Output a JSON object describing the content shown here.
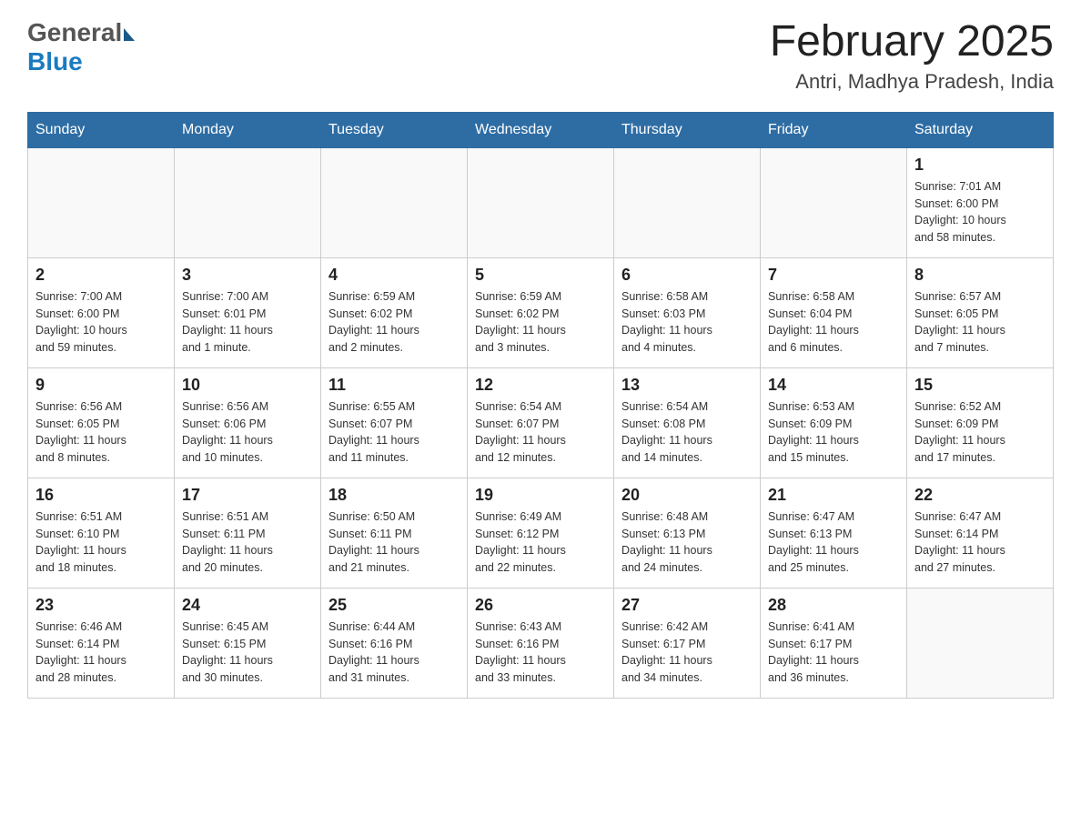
{
  "header": {
    "logo": {
      "general": "General",
      "blue": "Blue"
    },
    "title": "February 2025",
    "location": "Antri, Madhya Pradesh, India"
  },
  "days_of_week": [
    "Sunday",
    "Monday",
    "Tuesday",
    "Wednesday",
    "Thursday",
    "Friday",
    "Saturday"
  ],
  "weeks": [
    [
      {
        "day": "",
        "info": ""
      },
      {
        "day": "",
        "info": ""
      },
      {
        "day": "",
        "info": ""
      },
      {
        "day": "",
        "info": ""
      },
      {
        "day": "",
        "info": ""
      },
      {
        "day": "",
        "info": ""
      },
      {
        "day": "1",
        "info": "Sunrise: 7:01 AM\nSunset: 6:00 PM\nDaylight: 10 hours\nand 58 minutes."
      }
    ],
    [
      {
        "day": "2",
        "info": "Sunrise: 7:00 AM\nSunset: 6:00 PM\nDaylight: 10 hours\nand 59 minutes."
      },
      {
        "day": "3",
        "info": "Sunrise: 7:00 AM\nSunset: 6:01 PM\nDaylight: 11 hours\nand 1 minute."
      },
      {
        "day": "4",
        "info": "Sunrise: 6:59 AM\nSunset: 6:02 PM\nDaylight: 11 hours\nand 2 minutes."
      },
      {
        "day": "5",
        "info": "Sunrise: 6:59 AM\nSunset: 6:02 PM\nDaylight: 11 hours\nand 3 minutes."
      },
      {
        "day": "6",
        "info": "Sunrise: 6:58 AM\nSunset: 6:03 PM\nDaylight: 11 hours\nand 4 minutes."
      },
      {
        "day": "7",
        "info": "Sunrise: 6:58 AM\nSunset: 6:04 PM\nDaylight: 11 hours\nand 6 minutes."
      },
      {
        "day": "8",
        "info": "Sunrise: 6:57 AM\nSunset: 6:05 PM\nDaylight: 11 hours\nand 7 minutes."
      }
    ],
    [
      {
        "day": "9",
        "info": "Sunrise: 6:56 AM\nSunset: 6:05 PM\nDaylight: 11 hours\nand 8 minutes."
      },
      {
        "day": "10",
        "info": "Sunrise: 6:56 AM\nSunset: 6:06 PM\nDaylight: 11 hours\nand 10 minutes."
      },
      {
        "day": "11",
        "info": "Sunrise: 6:55 AM\nSunset: 6:07 PM\nDaylight: 11 hours\nand 11 minutes."
      },
      {
        "day": "12",
        "info": "Sunrise: 6:54 AM\nSunset: 6:07 PM\nDaylight: 11 hours\nand 12 minutes."
      },
      {
        "day": "13",
        "info": "Sunrise: 6:54 AM\nSunset: 6:08 PM\nDaylight: 11 hours\nand 14 minutes."
      },
      {
        "day": "14",
        "info": "Sunrise: 6:53 AM\nSunset: 6:09 PM\nDaylight: 11 hours\nand 15 minutes."
      },
      {
        "day": "15",
        "info": "Sunrise: 6:52 AM\nSunset: 6:09 PM\nDaylight: 11 hours\nand 17 minutes."
      }
    ],
    [
      {
        "day": "16",
        "info": "Sunrise: 6:51 AM\nSunset: 6:10 PM\nDaylight: 11 hours\nand 18 minutes."
      },
      {
        "day": "17",
        "info": "Sunrise: 6:51 AM\nSunset: 6:11 PM\nDaylight: 11 hours\nand 20 minutes."
      },
      {
        "day": "18",
        "info": "Sunrise: 6:50 AM\nSunset: 6:11 PM\nDaylight: 11 hours\nand 21 minutes."
      },
      {
        "day": "19",
        "info": "Sunrise: 6:49 AM\nSunset: 6:12 PM\nDaylight: 11 hours\nand 22 minutes."
      },
      {
        "day": "20",
        "info": "Sunrise: 6:48 AM\nSunset: 6:13 PM\nDaylight: 11 hours\nand 24 minutes."
      },
      {
        "day": "21",
        "info": "Sunrise: 6:47 AM\nSunset: 6:13 PM\nDaylight: 11 hours\nand 25 minutes."
      },
      {
        "day": "22",
        "info": "Sunrise: 6:47 AM\nSunset: 6:14 PM\nDaylight: 11 hours\nand 27 minutes."
      }
    ],
    [
      {
        "day": "23",
        "info": "Sunrise: 6:46 AM\nSunset: 6:14 PM\nDaylight: 11 hours\nand 28 minutes."
      },
      {
        "day": "24",
        "info": "Sunrise: 6:45 AM\nSunset: 6:15 PM\nDaylight: 11 hours\nand 30 minutes."
      },
      {
        "day": "25",
        "info": "Sunrise: 6:44 AM\nSunset: 6:16 PM\nDaylight: 11 hours\nand 31 minutes."
      },
      {
        "day": "26",
        "info": "Sunrise: 6:43 AM\nSunset: 6:16 PM\nDaylight: 11 hours\nand 33 minutes."
      },
      {
        "day": "27",
        "info": "Sunrise: 6:42 AM\nSunset: 6:17 PM\nDaylight: 11 hours\nand 34 minutes."
      },
      {
        "day": "28",
        "info": "Sunrise: 6:41 AM\nSunset: 6:17 PM\nDaylight: 11 hours\nand 36 minutes."
      },
      {
        "day": "",
        "info": ""
      }
    ]
  ]
}
